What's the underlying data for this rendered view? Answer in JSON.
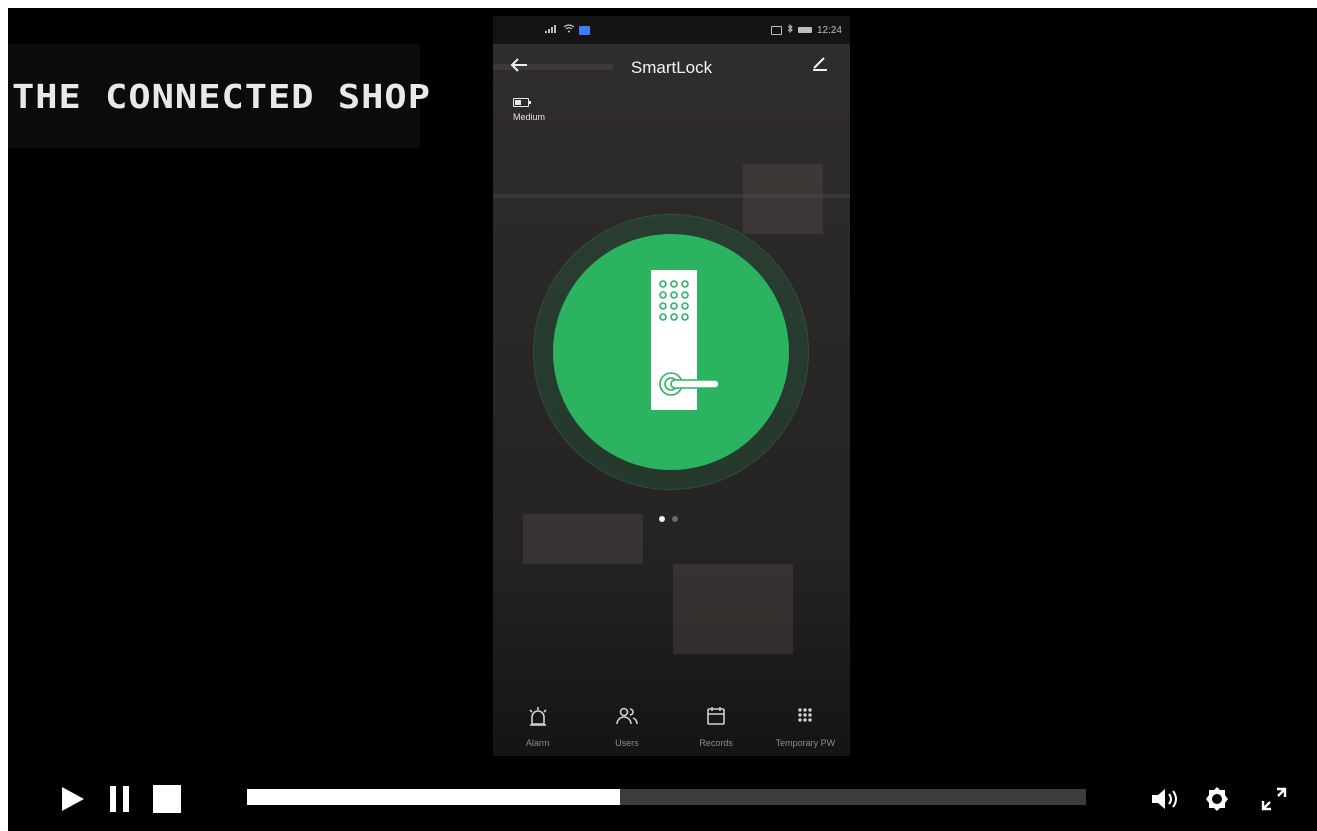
{
  "logo": {
    "text": "THE CONNECTED SHOP"
  },
  "phone": {
    "status": {
      "time": "12:24"
    },
    "header": {
      "title": "SmartLock"
    },
    "battery_label": "Medium",
    "nav_items": [
      {
        "label": "Alarm",
        "icon": "alarm-icon"
      },
      {
        "label": "Users",
        "icon": "users-icon"
      },
      {
        "label": "Records",
        "icon": "records-icon"
      },
      {
        "label": "Temporary PW",
        "icon": "keypad-icon"
      }
    ]
  },
  "player": {
    "progress": 0.445
  },
  "colors": {
    "lock_green": "#2bb360",
    "background": "#000000"
  }
}
